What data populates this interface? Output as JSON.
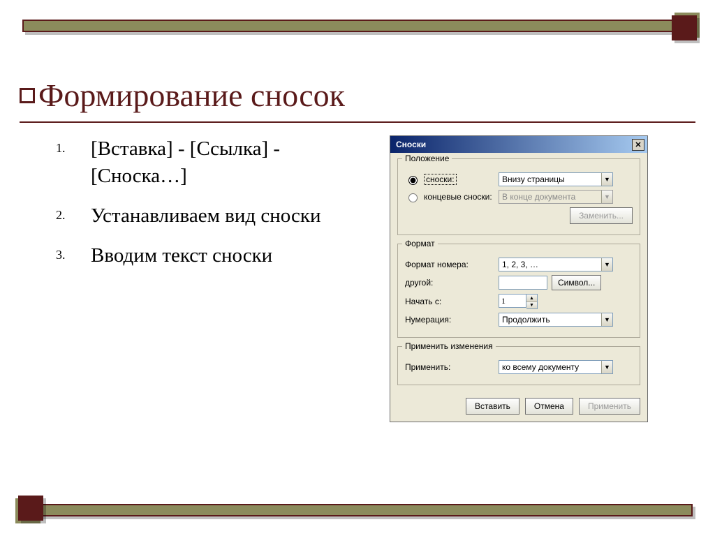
{
  "slide": {
    "title": "Формирование сносок",
    "steps": [
      "[Вставка] - [Ссылка] - [Сноска…]",
      "Устанавливаем вид сноски",
      "Вводим текст сноски"
    ]
  },
  "dialog": {
    "title": "Сноски",
    "sections": {
      "position": {
        "legend": "Положение",
        "footnote_radio": "сноски:",
        "footnote_value": "Внизу страницы",
        "endnote_radio": "концевые сноски:",
        "endnote_value": "В конце документа",
        "replace_btn": "Заменить..."
      },
      "format": {
        "legend": "Формат",
        "number_format_label": "Формат номера:",
        "number_format_value": "1, 2, 3, …",
        "other_label": "другой:",
        "other_value": "",
        "symbol_btn": "Символ...",
        "start_at_label": "Начать с:",
        "start_at_value": "1",
        "numbering_label": "Нумерация:",
        "numbering_value": "Продолжить"
      },
      "apply": {
        "legend": "Применить изменения",
        "apply_label": "Применить:",
        "apply_value": "ко всему документу"
      }
    },
    "buttons": {
      "insert": "Вставить",
      "cancel": "Отмена",
      "apply": "Применить"
    }
  }
}
